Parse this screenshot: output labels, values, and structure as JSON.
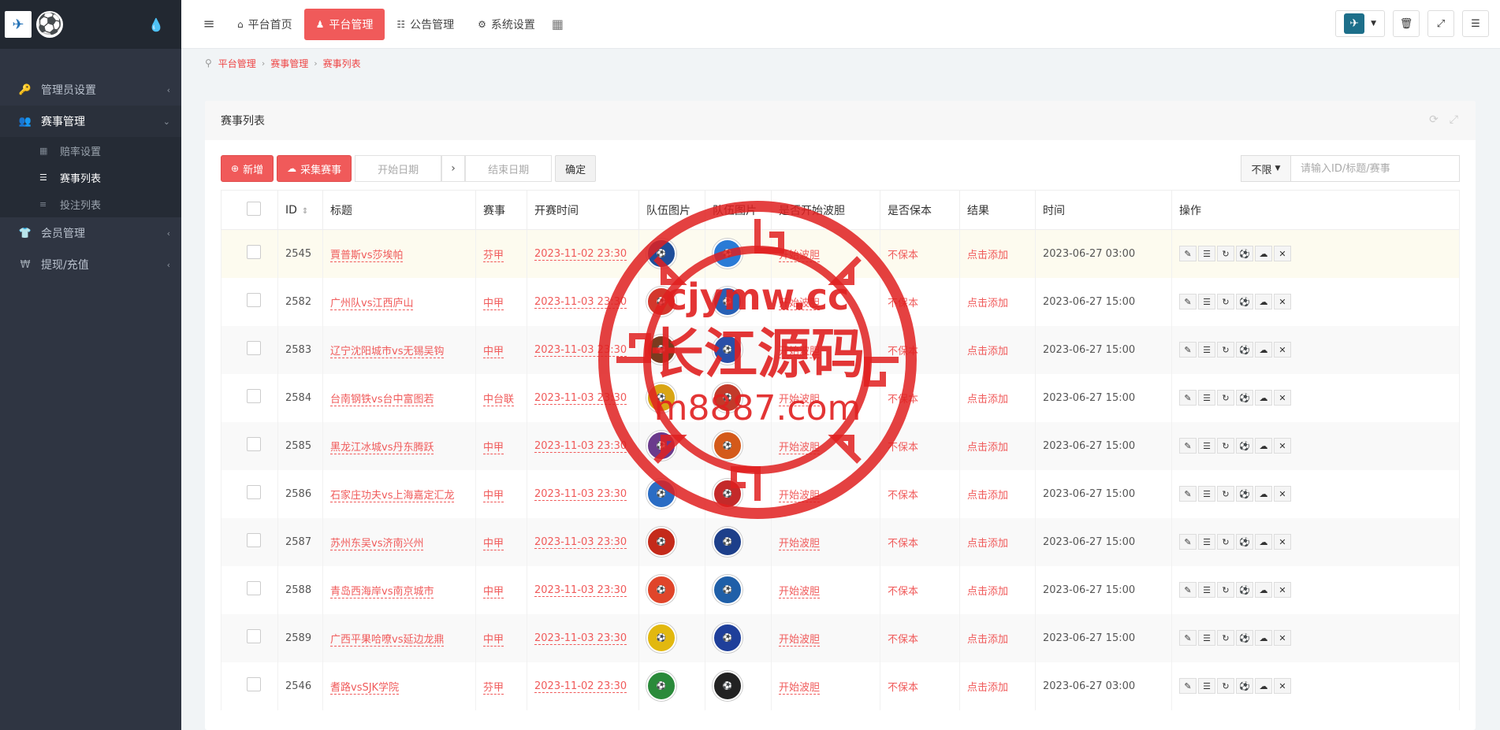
{
  "sidebar": {
    "drop_icon": "💧",
    "items": [
      {
        "label": "管理员设置",
        "icon": "🔑",
        "active": false
      },
      {
        "label": "赛事管理",
        "icon": "👥",
        "active": true
      },
      {
        "label": "会员管理",
        "icon": "👕",
        "active": false
      },
      {
        "label": "提现/充值",
        "icon": "₩",
        "active": false
      }
    ],
    "sub_items": [
      {
        "label": "赔率设置",
        "icon": "▦",
        "active": false
      },
      {
        "label": "赛事列表",
        "icon": "☰",
        "active": true
      },
      {
        "label": "投注列表",
        "icon": "≡",
        "active": false
      }
    ]
  },
  "topbar": {
    "nav": [
      {
        "label": "平台首页",
        "icon": "⌂",
        "active": false
      },
      {
        "label": "平台管理",
        "icon": "♟",
        "active": true
      },
      {
        "label": "公告管理",
        "icon": "☷",
        "active": false
      },
      {
        "label": "系统设置",
        "icon": "⚙",
        "active": false
      }
    ]
  },
  "breadcrumb": [
    "平台管理",
    "赛事管理",
    "赛事列表"
  ],
  "panel": {
    "title": "赛事列表",
    "add_label": "新增",
    "collect_label": "采集赛事",
    "start_date_placeholder": "开始日期",
    "end_date_placeholder": "结束日期",
    "confirm_label": "确定",
    "filter_value": "不限",
    "search_placeholder": "请输入ID/标题/赛事"
  },
  "table": {
    "headers": [
      "ID",
      "标题",
      "赛事",
      "开赛时间",
      "队伍图片",
      "队伍图片",
      "是否开始波胆",
      "是否保本",
      "结果",
      "时间",
      "操作"
    ],
    "rows": [
      {
        "id": "2545",
        "title": "賈普斯vs莎埃帕",
        "league": "芬甲",
        "start": "2023-11-02 23:30",
        "home_color": "#1f4e9a",
        "away_color": "#2a7bd6",
        "bodan": "开始波胆",
        "baoben": "不保本",
        "result": "点击添加",
        "time": "2023-06-27 03:00"
      },
      {
        "id": "2582",
        "title": "广州队vs江西庐山",
        "league": "中甲",
        "start": "2023-11-03 23:30",
        "home_color": "#d3372c",
        "away_color": "#2760b5",
        "bodan": "开始波胆",
        "baoben": "不保本",
        "result": "点击添加",
        "time": "2023-06-27 15:00"
      },
      {
        "id": "2583",
        "title": "辽宁沈阳城市vs无锡吴钩",
        "league": "中甲",
        "start": "2023-11-03 23:30",
        "home_color": "#7a3b1f",
        "away_color": "#2a4fa8",
        "bodan": "开始波胆",
        "baoben": "不保本",
        "result": "点击添加",
        "time": "2023-06-27 15:00"
      },
      {
        "id": "2584",
        "title": "台南钢铁vs台中富图若",
        "league": "中台联",
        "start": "2023-11-03 23:30",
        "home_color": "#d9a514",
        "away_color": "#c23a2a",
        "bodan": "开始波胆",
        "baoben": "不保本",
        "result": "点击添加",
        "time": "2023-06-27 15:00"
      },
      {
        "id": "2585",
        "title": "黑龙江冰城vs丹东腾跃",
        "league": "中甲",
        "start": "2023-11-03 23:30",
        "home_color": "#6a3a8c",
        "away_color": "#d45a1a",
        "bodan": "开始波胆",
        "baoben": "不保本",
        "result": "点击添加",
        "time": "2023-06-27 15:00"
      },
      {
        "id": "2586",
        "title": "石家庄功夫vs上海嘉定汇龙",
        "league": "中甲",
        "start": "2023-11-03 23:30",
        "home_color": "#2a6cc4",
        "away_color": "#c42a2a",
        "bodan": "开始波胆",
        "baoben": "不保本",
        "result": "点击添加",
        "time": "2023-06-27 15:00"
      },
      {
        "id": "2587",
        "title": "苏州东吴vs济南兴州",
        "league": "中甲",
        "start": "2023-11-03 23:30",
        "home_color": "#c42a1a",
        "away_color": "#1d3f8a",
        "bodan": "开始波胆",
        "baoben": "不保本",
        "result": "点击添加",
        "time": "2023-06-27 15:00"
      },
      {
        "id": "2588",
        "title": "青岛西海岸vs南京城市",
        "league": "中甲",
        "start": "2023-11-03 23:30",
        "home_color": "#e0452a",
        "away_color": "#1f5fa8",
        "bodan": "开始波胆",
        "baoben": "不保本",
        "result": "点击添加",
        "time": "2023-06-27 15:00"
      },
      {
        "id": "2589",
        "title": "广西平果哈嘹vs延边龙鼎",
        "league": "中甲",
        "start": "2023-11-03 23:30",
        "home_color": "#e2b80f",
        "away_color": "#1f3f9a",
        "bodan": "开始波胆",
        "baoben": "不保本",
        "result": "点击添加",
        "time": "2023-06-27 15:00"
      },
      {
        "id": "2546",
        "title": "耆路vsSJK学院",
        "league": "芬甲",
        "start": "2023-11-02 23:30",
        "home_color": "#2a8a3a",
        "away_color": "#222222",
        "bodan": "开始波胆",
        "baoben": "不保本",
        "result": "点击添加",
        "time": "2023-06-27 03:00"
      }
    ],
    "op_icons": [
      "✎",
      "☰",
      "↻",
      "⚽",
      "☁",
      "✕"
    ]
  },
  "watermark": {
    "line1": "cjymw.cc",
    "line2": "长江源码",
    "line3": "m8887.com"
  },
  "colors": {
    "accent": "#f05a5a",
    "sidebar": "#2f3542",
    "watermark": "#e02020"
  }
}
